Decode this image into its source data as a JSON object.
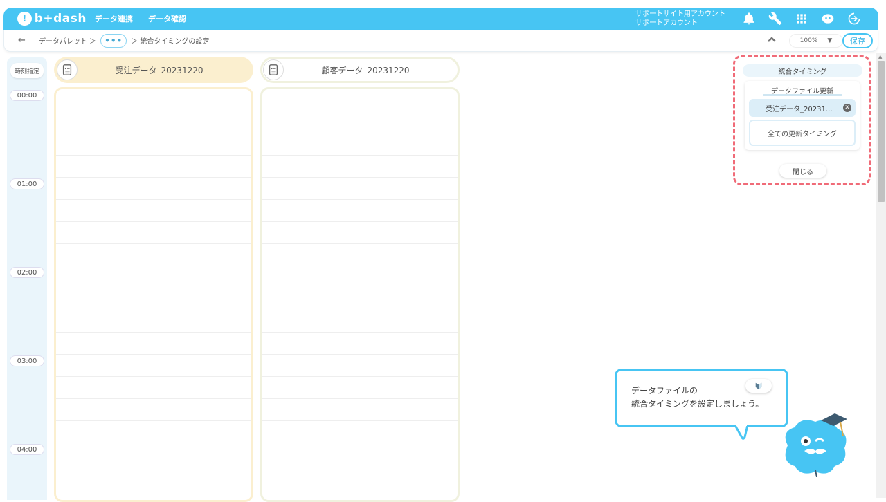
{
  "header": {
    "logo_text": "b+dash",
    "nav": [
      "データ連携",
      "データ確認"
    ],
    "account_line1": "サポートサイト用アカウント",
    "account_line2": "サポートアカウント",
    "icons": [
      "bell-icon",
      "wrench-icon",
      "grid-icon",
      "profile-icon",
      "logout-icon"
    ]
  },
  "subbar": {
    "back": "←",
    "crumb_root": "データパレット ＞",
    "more": "•••",
    "crumb_current": "＞ 統合タイミングの設定",
    "zoom": "100%",
    "save_label": "保存"
  },
  "timeline": {
    "header": "時刻指定",
    "ticks": [
      "00:00",
      "01:00",
      "02:00",
      "03:00",
      "04:00"
    ]
  },
  "columns": [
    {
      "title": "受注データ_20231220",
      "color": "#fbefcf"
    },
    {
      "title": "顧客データ_20231220",
      "color": "#f0f1de"
    }
  ],
  "panel": {
    "title": "統合タイミング",
    "subtitle": "データファイル更新",
    "selected": "受注データ_20231…",
    "all_label": "全ての更新タイミング",
    "close_label": "閉じる"
  },
  "tooltip": {
    "line1": "データファイルの",
    "line2": "統合タイミングを設定しましょう。"
  },
  "colors": {
    "accent": "#47c5f3",
    "highlight": "#f06b78"
  }
}
